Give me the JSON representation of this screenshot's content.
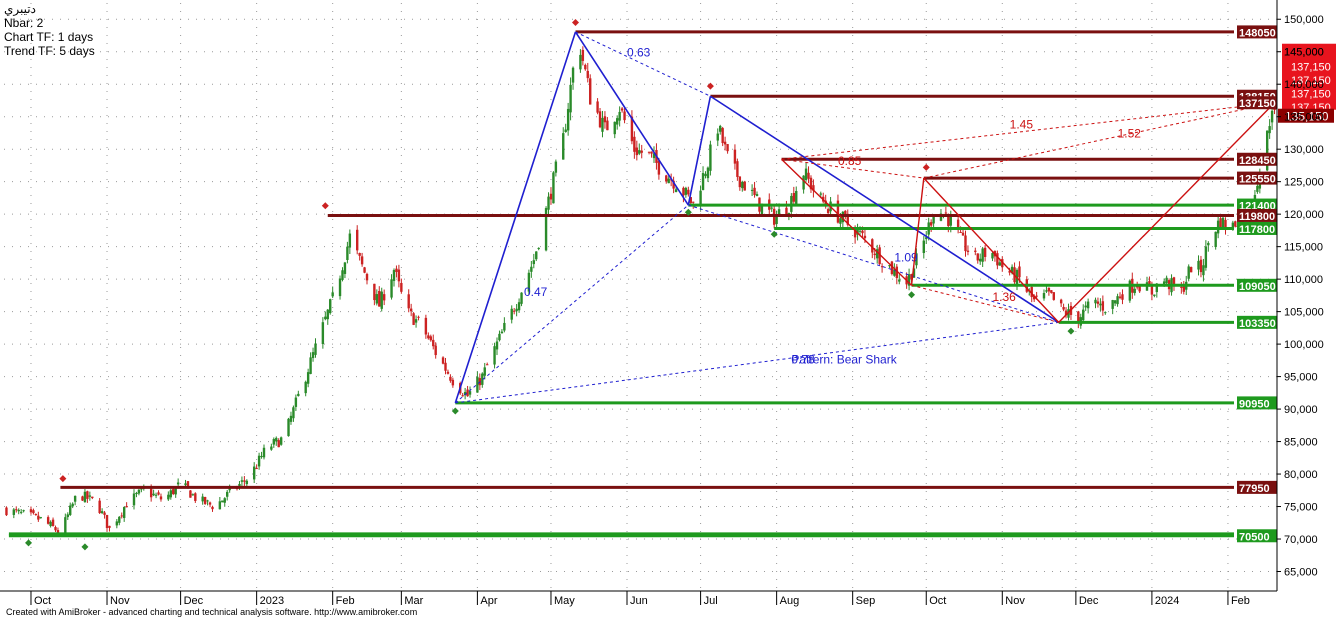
{
  "info": {
    "symbol": "دتيبري",
    "nbar": "Nbar: 2",
    "chart_tf": "Chart TF: 1 days",
    "trend_tf": "Trend TF: 5 days"
  },
  "footer": "Created with AmiBroker - advanced charting and technical analysis software. http://www.amibroker.com",
  "colors": {
    "up": "#2a8a2a",
    "down": "#cc2222",
    "support": "#1e9a1e",
    "resistance": "#7a1010",
    "harmonic_blue": "#1f1fd0",
    "harmonic_red": "#cc1111",
    "last_price": "#8b0000",
    "price_stack": "#e8141e"
  },
  "chart_data": {
    "type": "candlestick",
    "title": "",
    "ylim": [
      62000,
      152500
    ],
    "y_ticks": [
      150000,
      145000,
      140000,
      135000,
      130000,
      125000,
      120000,
      115000,
      110000,
      105000,
      100000,
      95000,
      90000,
      85000,
      80000,
      75000,
      70000,
      65000
    ],
    "y_tick_labels": [
      "150,000",
      "145,000",
      "140,000",
      "135,000",
      "130,000",
      "125,000",
      "120,000",
      "115,000",
      "110,000",
      "105,000",
      "100,000",
      "95,000",
      "90,000",
      "85,000",
      "80,000",
      "75,000",
      "70,000",
      "65,000"
    ],
    "x_labels": [
      {
        "label": "Oct",
        "date": "2022-10-01"
      },
      {
        "label": "Nov",
        "date": "2022-11-01"
      },
      {
        "label": "Dec",
        "date": "2022-12-01"
      },
      {
        "label": "2023",
        "date": "2023-01-01"
      },
      {
        "label": "Feb",
        "date": "2023-02-01"
      },
      {
        "label": "Mar",
        "date": "2023-03-01"
      },
      {
        "label": "Apr",
        "date": "2023-04-01"
      },
      {
        "label": "May",
        "date": "2023-05-01"
      },
      {
        "label": "Jun",
        "date": "2023-06-01"
      },
      {
        "label": "Jul",
        "date": "2023-07-01"
      },
      {
        "label": "Aug",
        "date": "2023-08-01"
      },
      {
        "label": "Sep",
        "date": "2023-09-01"
      },
      {
        "label": "Oct",
        "date": "2023-10-01"
      },
      {
        "label": "Nov",
        "date": "2023-11-01"
      },
      {
        "label": "Dec",
        "date": "2023-12-01"
      },
      {
        "label": "2024",
        "date": "2024-01-01"
      },
      {
        "label": "Feb",
        "date": "2024-02-01"
      }
    ],
    "xlim": [
      "2022-09-20",
      "2024-02-21"
    ],
    "price_path": [
      {
        "date": "2022-09-21",
        "value": 74500
      },
      {
        "date": "2022-10-05",
        "value": 73000
      },
      {
        "date": "2022-10-13",
        "value": 71000
      },
      {
        "date": "2022-10-20",
        "value": 77000
      },
      {
        "date": "2022-10-28",
        "value": 75500
      },
      {
        "date": "2022-11-02",
        "value": 71500
      },
      {
        "date": "2022-11-09",
        "value": 75500
      },
      {
        "date": "2022-11-16",
        "value": 77500
      },
      {
        "date": "2022-11-24",
        "value": 76000
      },
      {
        "date": "2022-12-01",
        "value": 78500
      },
      {
        "date": "2022-12-08",
        "value": 76000
      },
      {
        "date": "2022-12-15",
        "value": 75000
      },
      {
        "date": "2022-12-22",
        "value": 77500
      },
      {
        "date": "2022-12-29",
        "value": 79500
      },
      {
        "date": "2023-01-05",
        "value": 84000
      },
      {
        "date": "2023-01-12",
        "value": 85500
      },
      {
        "date": "2023-01-19",
        "value": 93000
      },
      {
        "date": "2023-01-26",
        "value": 100500
      },
      {
        "date": "2023-02-02",
        "value": 108000
      },
      {
        "date": "2023-02-08",
        "value": 116500
      },
      {
        "date": "2023-02-14",
        "value": 111000
      },
      {
        "date": "2023-02-20",
        "value": 106000
      },
      {
        "date": "2023-02-26",
        "value": 111500
      },
      {
        "date": "2023-03-03",
        "value": 105000
      },
      {
        "date": "2023-03-09",
        "value": 103000
      },
      {
        "date": "2023-03-16",
        "value": 98000
      },
      {
        "date": "2023-03-22",
        "value": 94500
      },
      {
        "date": "2023-03-28",
        "value": 92000
      },
      {
        "date": "2023-04-03",
        "value": 95000
      },
      {
        "date": "2023-04-09",
        "value": 100000
      },
      {
        "date": "2023-04-17",
        "value": 106500
      },
      {
        "date": "2023-04-24",
        "value": 113000
      },
      {
        "date": "2023-04-30",
        "value": 122000
      },
      {
        "date": "2023-05-06",
        "value": 131500
      },
      {
        "date": "2023-05-12",
        "value": 147500
      },
      {
        "date": "2023-05-17",
        "value": 138000
      },
      {
        "date": "2023-05-23",
        "value": 133000
      },
      {
        "date": "2023-05-29",
        "value": 136500
      },
      {
        "date": "2023-06-04",
        "value": 130000
      },
      {
        "date": "2023-06-10",
        "value": 129000
      },
      {
        "date": "2023-06-16",
        "value": 126500
      },
      {
        "date": "2023-06-22",
        "value": 124500
      },
      {
        "date": "2023-06-28",
        "value": 121500
      },
      {
        "date": "2023-07-04",
        "value": 128000
      },
      {
        "date": "2023-07-08",
        "value": 133500
      },
      {
        "date": "2023-07-13",
        "value": 127500
      },
      {
        "date": "2023-07-19",
        "value": 124500
      },
      {
        "date": "2023-07-25",
        "value": 121500
      },
      {
        "date": "2023-07-31",
        "value": 119500
      },
      {
        "date": "2023-08-06",
        "value": 121500
      },
      {
        "date": "2023-08-12",
        "value": 126500
      },
      {
        "date": "2023-08-18",
        "value": 122500
      },
      {
        "date": "2023-08-24",
        "value": 120500
      },
      {
        "date": "2023-08-30",
        "value": 118500
      },
      {
        "date": "2023-09-05",
        "value": 116500
      },
      {
        "date": "2023-09-11",
        "value": 114000
      },
      {
        "date": "2023-09-17",
        "value": 111500
      },
      {
        "date": "2023-09-23",
        "value": 109500
      },
      {
        "date": "2023-09-29",
        "value": 114500
      },
      {
        "date": "2023-10-04",
        "value": 120500
      },
      {
        "date": "2023-10-09",
        "value": 120000
      },
      {
        "date": "2023-10-15",
        "value": 116000
      },
      {
        "date": "2023-10-21",
        "value": 113000
      },
      {
        "date": "2023-10-27",
        "value": 114500
      },
      {
        "date": "2023-11-02",
        "value": 111500
      },
      {
        "date": "2023-11-08",
        "value": 110000
      },
      {
        "date": "2023-11-14",
        "value": 106500
      },
      {
        "date": "2023-11-20",
        "value": 107500
      },
      {
        "date": "2023-11-26",
        "value": 105000
      },
      {
        "date": "2023-12-02",
        "value": 104000
      },
      {
        "date": "2023-12-08",
        "value": 106500
      },
      {
        "date": "2023-12-14",
        "value": 105500
      },
      {
        "date": "2023-12-20",
        "value": 108000
      },
      {
        "date": "2023-12-26",
        "value": 109500
      },
      {
        "date": "2024-01-01",
        "value": 108000
      },
      {
        "date": "2024-01-05",
        "value": 110000
      },
      {
        "date": "2024-01-09",
        "value": 109000
      },
      {
        "date": "2024-01-13",
        "value": 108000
      },
      {
        "date": "2024-01-17",
        "value": 112000
      },
      {
        "date": "2024-01-21",
        "value": 111500
      },
      {
        "date": "2024-01-25",
        "value": 117000
      },
      {
        "date": "2024-01-29",
        "value": 119000
      },
      {
        "date": "2024-02-02",
        "value": 117500
      },
      {
        "date": "2024-02-06",
        "value": 120000
      },
      {
        "date": "2024-02-09",
        "value": 118500
      },
      {
        "date": "2024-02-13",
        "value": 125500
      },
      {
        "date": "2024-02-16",
        "value": 129500
      },
      {
        "date": "2024-02-19",
        "value": 137000
      },
      {
        "date": "2024-02-20",
        "value": 135150
      }
    ],
    "levels": [
      {
        "value": 148050,
        "label": "148050",
        "kind": "resistance",
        "from": "2023-05-11"
      },
      {
        "value": 138150,
        "label": "138150",
        "kind": "resistance",
        "from": "2023-07-05"
      },
      {
        "value": 128450,
        "label": "128450",
        "kind": "resistance",
        "from": "2023-08-03"
      },
      {
        "value": 125550,
        "label": "125550",
        "kind": "resistance",
        "from": "2023-09-30"
      },
      {
        "value": 121400,
        "label": "121400",
        "kind": "support",
        "from": "2023-06-26"
      },
      {
        "value": 119800,
        "label": "119800",
        "kind": "resistance",
        "from": "2023-01-30"
      },
      {
        "value": 117800,
        "label": "117800",
        "kind": "support",
        "from": "2023-07-31"
      },
      {
        "value": 109050,
        "label": "109050",
        "kind": "support",
        "from": "2023-09-25"
      },
      {
        "value": 103350,
        "label": "103350",
        "kind": "support",
        "from": "2023-11-24"
      },
      {
        "value": 90950,
        "label": "90950",
        "kind": "support",
        "from": "2023-03-23"
      },
      {
        "value": 77950,
        "label": "77950",
        "kind": "resistance",
        "from": "2022-10-13"
      },
      {
        "value": 70800,
        "label": "",
        "kind": "support",
        "from": "2022-09-22"
      },
      {
        "value": 70500,
        "label": "70500",
        "kind": "support",
        "from": "2022-09-22"
      }
    ],
    "pivots": [
      {
        "date": "2022-10-14",
        "value": 79300,
        "kind": "high"
      },
      {
        "date": "2022-09-30",
        "value": 69400,
        "kind": "low"
      },
      {
        "date": "2022-10-23",
        "value": 68800,
        "kind": "low"
      },
      {
        "date": "2023-01-29",
        "value": 121300,
        "kind": "high"
      },
      {
        "date": "2023-03-23",
        "value": 89700,
        "kind": "low"
      },
      {
        "date": "2023-05-11",
        "value": 149500,
        "kind": "high"
      },
      {
        "date": "2023-07-05",
        "value": 139700,
        "kind": "high"
      },
      {
        "date": "2023-06-26",
        "value": 120300,
        "kind": "low"
      },
      {
        "date": "2023-07-31",
        "value": 116900,
        "kind": "low"
      },
      {
        "date": "2023-09-25",
        "value": 107600,
        "kind": "low"
      },
      {
        "date": "2023-10-01",
        "value": 127200,
        "kind": "high"
      },
      {
        "date": "2023-11-29",
        "value": 102000,
        "kind": "low"
      }
    ],
    "harmonic_blue": {
      "label": "Pattern: Bear Shark",
      "label_overlap": "0.78",
      "points": [
        {
          "date": "2023-03-23",
          "value": 90950
        },
        {
          "date": "2023-05-11",
          "value": 148050
        },
        {
          "date": "2023-06-26",
          "value": 121400
        },
        {
          "date": "2023-07-05",
          "value": 138150
        },
        {
          "date": "2023-11-24",
          "value": 103350
        }
      ],
      "ratios": [
        {
          "text": "0.63",
          "date": "2023-06-01",
          "value": 144300
        },
        {
          "text": "0.47",
          "date": "2023-04-20",
          "value": 107400
        },
        {
          "text": "1.09",
          "date": "2023-09-18",
          "value": 112700
        }
      ]
    },
    "harmonic_red": {
      "points": [
        {
          "date": "2023-08-03",
          "value": 128450
        },
        {
          "date": "2023-09-25",
          "value": 109050
        },
        {
          "date": "2023-09-30",
          "value": 125550
        },
        {
          "date": "2023-11-24",
          "value": 103350
        },
        {
          "date": "2024-02-20",
          "value": 137150
        }
      ],
      "ratios": [
        {
          "text": "0.85",
          "date": "2023-08-26",
          "value": 127600
        },
        {
          "text": "1.45",
          "date": "2023-11-04",
          "value": 133200
        },
        {
          "text": "1.52",
          "date": "2023-12-18",
          "value": 131800
        },
        {
          "text": "1.36",
          "date": "2023-10-28",
          "value": 106600
        }
      ]
    },
    "price_stack": [
      "137,150",
      "137,150",
      "137,150",
      "137,150"
    ],
    "last_price": "135,150",
    "price_stack_top": "145,000",
    "badge_extra": "137150"
  }
}
